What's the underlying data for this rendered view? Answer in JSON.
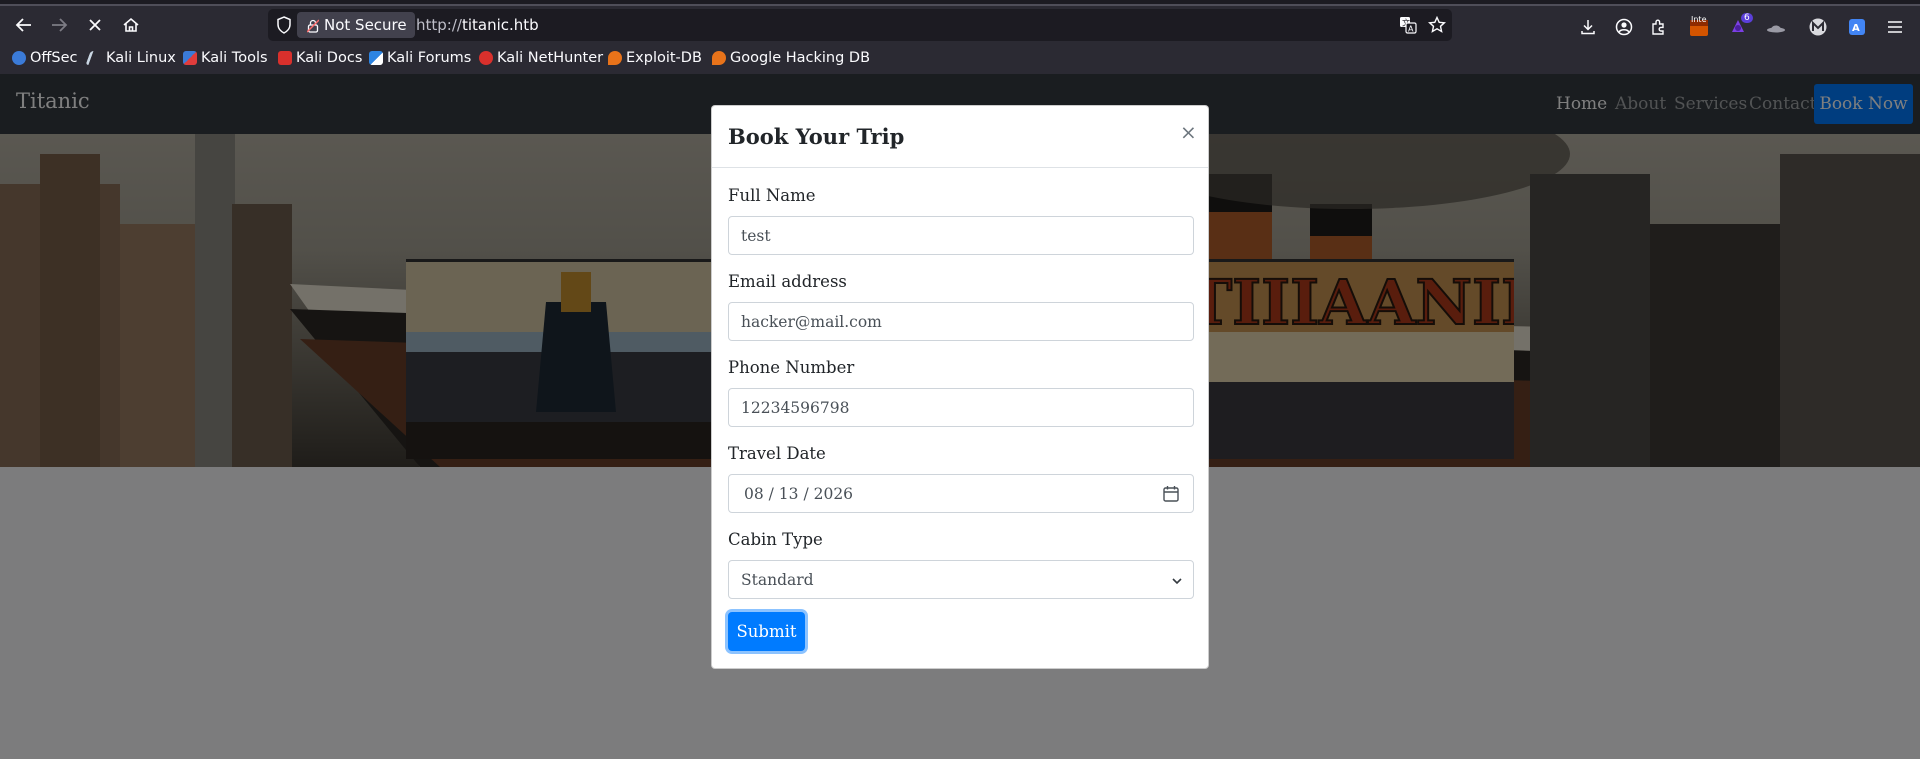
{
  "browser": {
    "url_scheme": "http://",
    "url_host": "titanic.htb",
    "not_secure_label": "Not Secure",
    "bookmarks": [
      {
        "label": "OffSec",
        "color": "#3b7bd8"
      },
      {
        "label": "Kali Linux",
        "color": "#5b9bd5"
      },
      {
        "label": "Kali Tools",
        "color": "#e03c3c"
      },
      {
        "label": "Kali Docs",
        "color": "#d9302c"
      },
      {
        "label": "Kali Forums",
        "color": "#2d84e2"
      },
      {
        "label": "Kali NetHunter",
        "color": "#d9302c"
      },
      {
        "label": "Exploit-DB",
        "color": "#e8731a"
      },
      {
        "label": "Google Hacking DB",
        "color": "#e8731a"
      }
    ],
    "extension_badge": "6",
    "extension_tag": "Inte"
  },
  "site": {
    "brand": "Titanic",
    "nav": [
      {
        "label": "Home",
        "active": true
      },
      {
        "label": "About",
        "active": false
      },
      {
        "label": "Services",
        "active": false
      },
      {
        "label": "Contact",
        "active": false
      }
    ],
    "book_now": "Book Now"
  },
  "modal": {
    "title": "Book Your Trip",
    "close_glyph": "×",
    "fields": {
      "full_name": {
        "label": "Full Name",
        "value": "test"
      },
      "email": {
        "label": "Email address",
        "value": "hacker@mail.com"
      },
      "phone": {
        "label": "Phone Number",
        "value": "12234596798"
      },
      "travel_date": {
        "label": "Travel Date",
        "value": "08 / 13 / 2026"
      },
      "cabin": {
        "label": "Cabin Type",
        "value": "Standard"
      }
    },
    "submit": "Submit"
  },
  "icons": {
    "back": "back-arrow-icon",
    "forward": "forward-arrow-icon",
    "stop": "stop-loading-icon",
    "home": "home-icon",
    "translate": "translate-icon",
    "bookmark_star": "star-icon",
    "downloads": "download-icon",
    "account": "account-icon",
    "extensions": "extensions-icon",
    "menu": "hamburger-menu-icon",
    "calendar": "calendar-icon",
    "select_chevron": "chevron-down-icon"
  },
  "colors": {
    "accent": "#007bff",
    "navbar": "#343a40",
    "browser_chrome": "#2b2a33"
  }
}
